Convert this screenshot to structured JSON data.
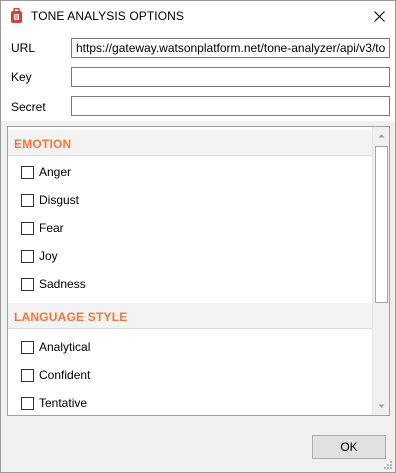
{
  "window": {
    "title": "TONE ANALYSIS OPTIONS"
  },
  "icons": {
    "app": "app-icon",
    "close": "close-icon",
    "scroll_up": "chevron-up-icon",
    "scroll_down": "chevron-down-icon",
    "grip": "resize-grip-icon"
  },
  "colors": {
    "section_header_text": "#f07838",
    "app_icon": "#e03c31"
  },
  "fields": {
    "url": {
      "label": "URL",
      "value": "https://gateway.watsonplatform.net/tone-analyzer/api/v3/to"
    },
    "key": {
      "label": "Key",
      "value": ""
    },
    "secret": {
      "label": "Secret",
      "value": ""
    }
  },
  "sections": [
    {
      "title": "EMOTION",
      "items": [
        {
          "label": "Anger",
          "checked": false
        },
        {
          "label": "Disgust",
          "checked": false
        },
        {
          "label": "Fear",
          "checked": false
        },
        {
          "label": "Joy",
          "checked": false
        },
        {
          "label": "Sadness",
          "checked": false
        }
      ]
    },
    {
      "title": "LANGUAGE STYLE",
      "items": [
        {
          "label": "Analytical",
          "checked": false
        },
        {
          "label": "Confident",
          "checked": false
        },
        {
          "label": "Tentative",
          "checked": false
        }
      ]
    }
  ],
  "footer": {
    "ok_label": "OK"
  }
}
